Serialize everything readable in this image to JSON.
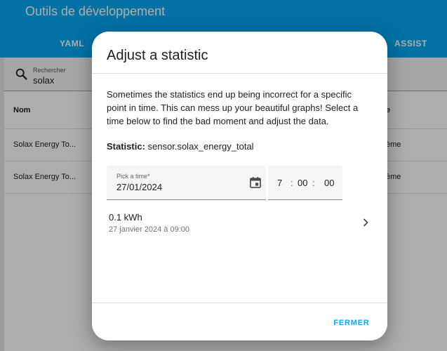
{
  "app": {
    "title": "Outils de développement",
    "tabs": [
      {
        "label": "YAML"
      },
      {
        "label": "ASSIST"
      }
    ]
  },
  "search": {
    "label": "Rechercher",
    "value": "solax"
  },
  "table": {
    "headers": {
      "name": "Nom",
      "right": "e"
    },
    "rows": [
      {
        "name": "Solax Energy To...",
        "right": "ème"
      },
      {
        "name": "Solax Energy To...",
        "right": "ème"
      }
    ]
  },
  "dialog": {
    "title": "Adjust a statistic",
    "description": "Sometimes the statistics end up being incorrect for a specific point in time. This can mess up your beautiful graphs! Select a time below to find the bad moment and adjust the data.",
    "statistic_label": "Statistic:",
    "statistic_value": "sensor.solax_energy_total",
    "date_field": {
      "label": "Pick a time*",
      "value": "27/01/2024"
    },
    "time_field": {
      "hours": "7",
      "minutes": "00",
      "seconds": "00",
      "separator": ":"
    },
    "stat_item": {
      "value": "0.1 kWh",
      "date": "27 janvier 2024 à 09:00"
    },
    "close_label": "FERMER"
  },
  "colors": {
    "primary": "#03a9f4",
    "text": "#212121",
    "secondary_text": "#727272"
  }
}
